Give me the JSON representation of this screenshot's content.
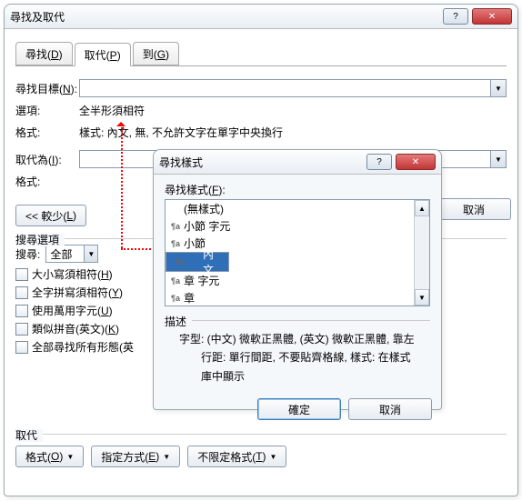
{
  "main": {
    "title": "尋找及取代",
    "tabs": [
      {
        "label_pre": "尋找(",
        "hot": "D",
        "label_post": ")"
      },
      {
        "label_pre": "取代(",
        "hot": "P",
        "label_post": ")"
      },
      {
        "label_pre": "到(",
        "hot": "G",
        "label_post": ")"
      }
    ],
    "find_label_pre": "尋找目標(",
    "find_hot": "N",
    "find_label_post": "):",
    "options_label": "選項:",
    "options_value": "全半形須相符",
    "format_label": "格式:",
    "format_value": "樣式: 內文, 無, 不允許文字在單字中央換行",
    "replace_label_pre": "取代為(",
    "replace_hot": "I",
    "replace_label_post": "):",
    "format2_label": "格式:",
    "less_btn_pre": "<< 較少(",
    "less_hot": "L",
    "less_btn_post": ")",
    "right_buttons": [
      "取消"
    ],
    "search_opts_hdr": "搜尋選項",
    "search_dir_label": "搜尋:",
    "search_dir_value": "全部",
    "checks": [
      {
        "pre": "大小寫須相符(",
        "hot": "H",
        "post": ")"
      },
      {
        "pre": "全字拼寫須相符(",
        "hot": "Y",
        "post": ")"
      },
      {
        "pre": "使用萬用字元(",
        "hot": "U",
        "post": ")"
      },
      {
        "pre": "類似拼音(英文)(",
        "hot": "K",
        "post": ")"
      },
      {
        "pre": "全部尋找所有形態(英",
        "hot": "",
        "post": ""
      }
    ],
    "repl_hdr": "取代",
    "bottom_buttons": [
      {
        "pre": "格式(",
        "hot": "O",
        "post": ")"
      },
      {
        "pre": "指定方式(",
        "hot": "E",
        "post": ")"
      },
      {
        "pre": "不限定格式(",
        "hot": "T",
        "post": ")"
      }
    ]
  },
  "modal": {
    "title": "尋找樣式",
    "list_label_pre": "尋找樣式(",
    "list_hot": "F",
    "list_label_post": "):",
    "items": [
      {
        "t": "(無樣式)",
        "pi": ""
      },
      {
        "t": "小節 字元",
        "pi": "¶a"
      },
      {
        "t": "小節",
        "pi": "¶a"
      },
      {
        "t": "內文",
        "pi": "¶a",
        "sel": true
      },
      {
        "t": "章 字元",
        "pi": "¶a"
      },
      {
        "t": "章",
        "pi": "¶a"
      }
    ],
    "desc_label": "描述",
    "desc_line1": "字型: (中文) 微軟正黑體, (英文) 微軟正黑體, 靠左",
    "desc_line2": "行距: 單行間距, 不要貼齊格線, 樣式: 在樣式庫中顯示",
    "ok": "確定",
    "cancel": "取消"
  }
}
